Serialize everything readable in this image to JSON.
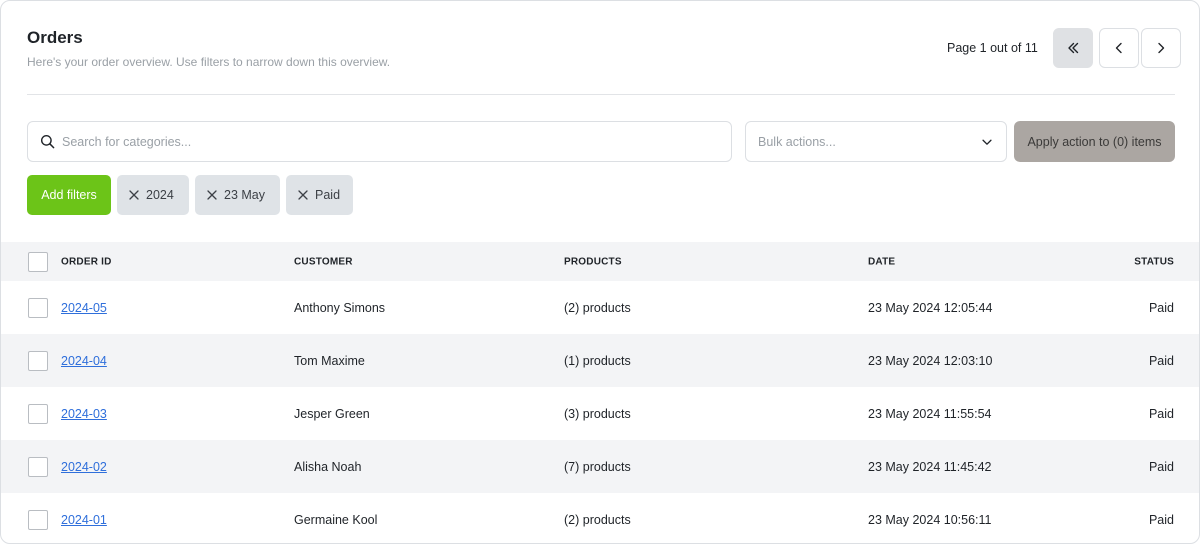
{
  "header": {
    "title": "Orders",
    "subtitle": "Here's your order overview. Use filters to narrow down this overview."
  },
  "pagination": {
    "label": "Page 1 out of 11",
    "current_page": 1,
    "total_pages": 11,
    "first_icon": "double-chevron-left-icon",
    "prev_icon": "chevron-left-icon",
    "next_icon": "chevron-right-icon"
  },
  "toolbar": {
    "search_placeholder": "Search for categories...",
    "search_icon": "search-icon",
    "bulk_placeholder": "Bulk actions...",
    "bulk_icon": "chevron-down-icon",
    "apply_label": "Apply action to (0) items",
    "add_filters_label": "Add filters"
  },
  "filters": [
    {
      "label": "2024"
    },
    {
      "label": "23 May"
    },
    {
      "label": "Paid"
    }
  ],
  "table": {
    "columns": {
      "order_id": "ORDER ID",
      "customer": "CUSTOMER",
      "products": "PRODUCTS",
      "date": "DATE",
      "status": "STATUS"
    },
    "rows": [
      {
        "id": "2024-05",
        "customer": "Anthony Simons",
        "products": "(2) products",
        "date": "23 May 2024 12:05:44",
        "status": "Paid"
      },
      {
        "id": "2024-04",
        "customer": "Tom Maxime",
        "products": "(1) products",
        "date": "23 May 2024 12:03:10",
        "status": "Paid"
      },
      {
        "id": "2024-03",
        "customer": "Jesper Green",
        "products": "(3) products",
        "date": "23 May 2024 11:55:54",
        "status": "Paid"
      },
      {
        "id": "2024-02",
        "customer": "Alisha Noah",
        "products": "(7) products",
        "date": "23 May 2024 11:45:42",
        "status": "Paid"
      },
      {
        "id": "2024-01",
        "customer": "Germaine Kool",
        "products": "(2) products",
        "date": "23 May 2024 10:56:11",
        "status": "Paid"
      }
    ]
  },
  "colors": {
    "accent_green": "#6cc418",
    "apply_button": "#aba6a2",
    "link_blue": "#2f6fdb",
    "chip_bg": "#dfe3e7",
    "row_alt": "#f3f4f6"
  }
}
